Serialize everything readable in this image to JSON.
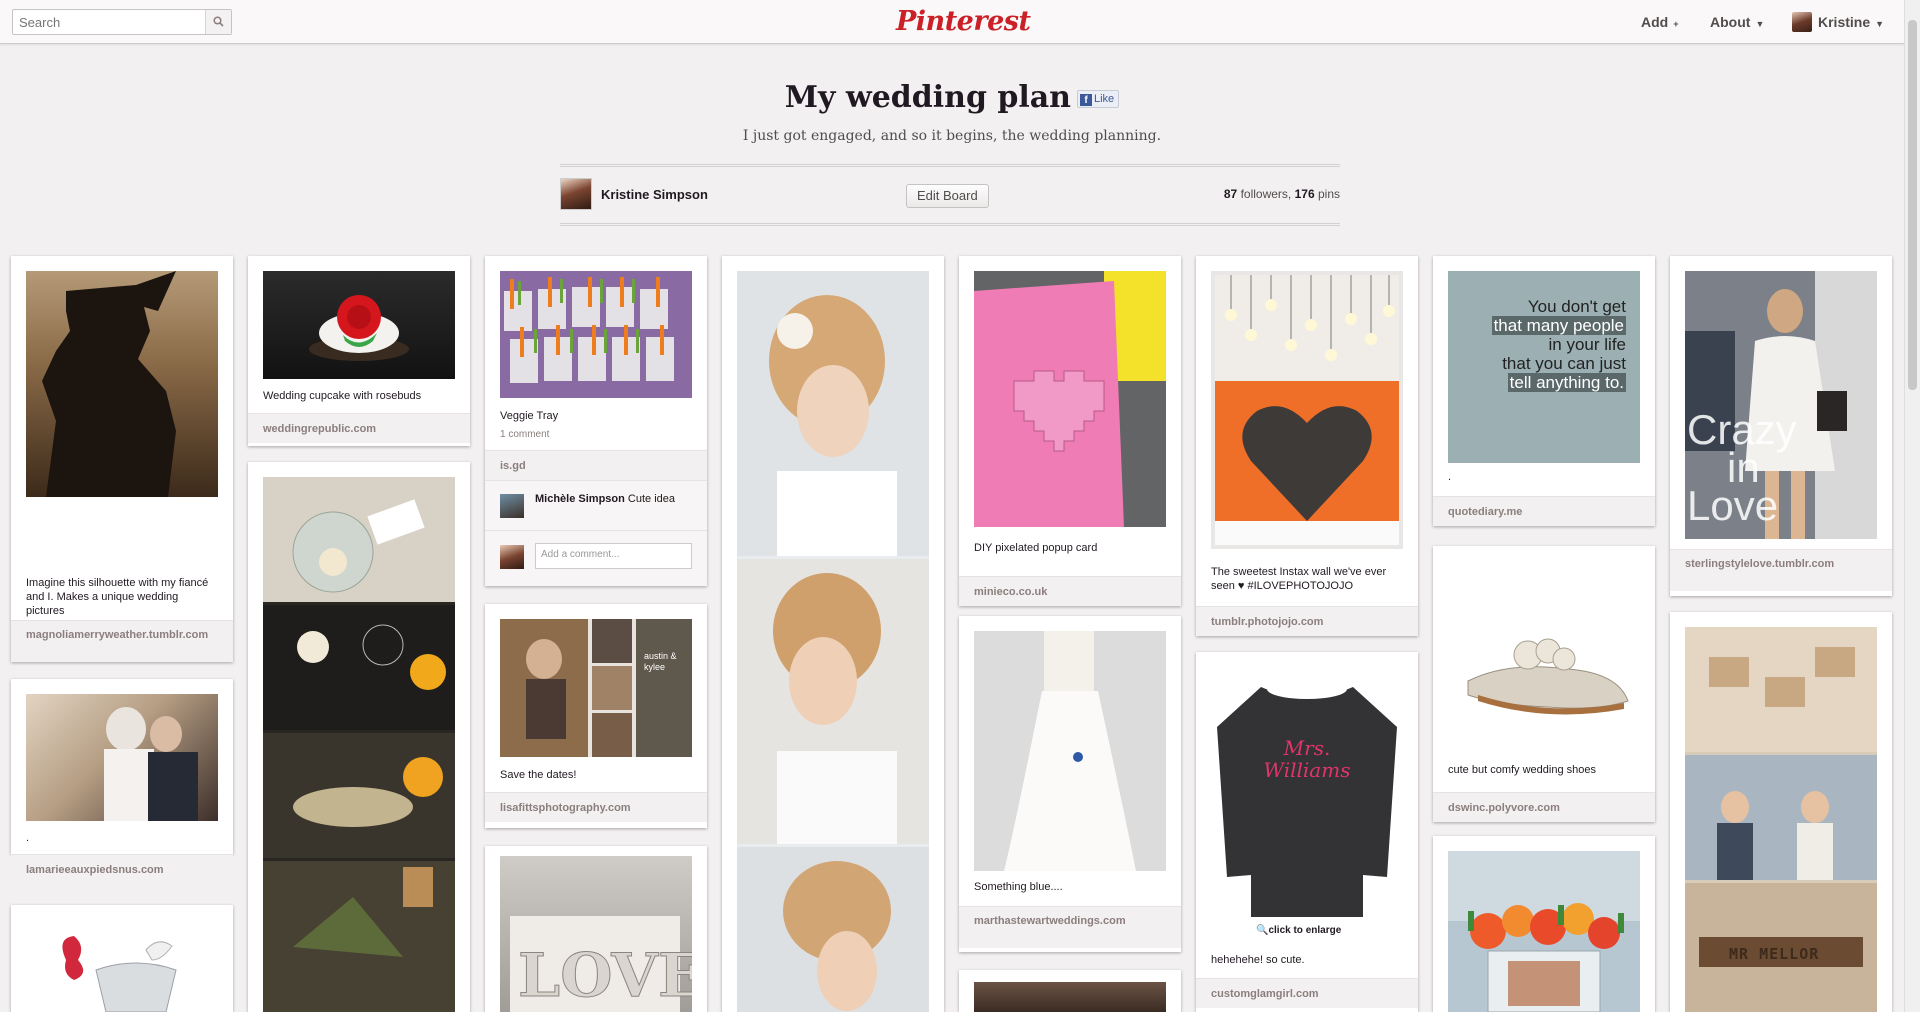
{
  "header": {
    "search_placeholder": "Search",
    "logo": "Pinterest",
    "nav_add": "Add",
    "nav_about": "About",
    "nav_user": "Kristine"
  },
  "board": {
    "title": "My wedding plan",
    "fb_like": "Like",
    "description": "I just got engaged, and so it begins, the wedding planning.",
    "owner": "Kristine Simpson",
    "edit_label": "Edit Board",
    "followers_count": "87",
    "followers_label": "followers,",
    "pins_count": "176",
    "pins_label": "pins"
  },
  "pins": {
    "silhouette": {
      "desc": "Imagine this silhouette with my fiancé and I. Makes a unique wedding pictures",
      "source": "magnoliamerryweather.tumblr.com"
    },
    "couple": {
      "desc": ".",
      "source": "lamarieeauxpiedsnus.com"
    },
    "cupcake": {
      "desc": "Wedding cupcake with rosebuds",
      "source": "weddingrepublic.com"
    },
    "veggie": {
      "desc": "Veggie Tray",
      "comments": "1 comment",
      "source": "is.gd",
      "commenter": "Michèle Simpson",
      "comment": "Cute idea",
      "add_comment": "Add a comment..."
    },
    "save_dates": {
      "desc": "Save the dates!",
      "source": "lisafittsphotography.com",
      "card_text": "austin & kylee"
    },
    "pixel_card": {
      "desc": "DIY pixelated popup card",
      "source": "minieco.co.uk"
    },
    "something_blue": {
      "desc": "Something blue....",
      "source": "marthastewartweddings.com"
    },
    "instax": {
      "desc": "The sweetest Instax wall we've ever seen ♥ #ILOVEPHOTOJOJO",
      "source": "tumblr.photojojo.com"
    },
    "sweater": {
      "desc": "hehehehe! so cute.",
      "source": "customglamgirl.com",
      "print": "Mrs. Williams",
      "overlay": "click to enlarge"
    },
    "quote": {
      "desc": ".",
      "source": "quotediary.me",
      "line1": "You don't get",
      "line2": "that many people",
      "line3": "in your life",
      "line4": "that you can just",
      "line5": "tell anything to."
    },
    "shoes": {
      "desc": "cute but comfy wedding shoes",
      "source": "dswinc.polyvore.com"
    },
    "crazy_love": {
      "source": "sterlingstylelove.tumblr.com",
      "overlay1": "Crazy",
      "overlay2": "in",
      "overlay3": "Love"
    },
    "mr_mellor": {
      "tiles": "MR MELLOR"
    }
  },
  "colors": {
    "brand": "#cb2027",
    "background": "#f2f0f0",
    "fb_blue": "#3b5998"
  }
}
